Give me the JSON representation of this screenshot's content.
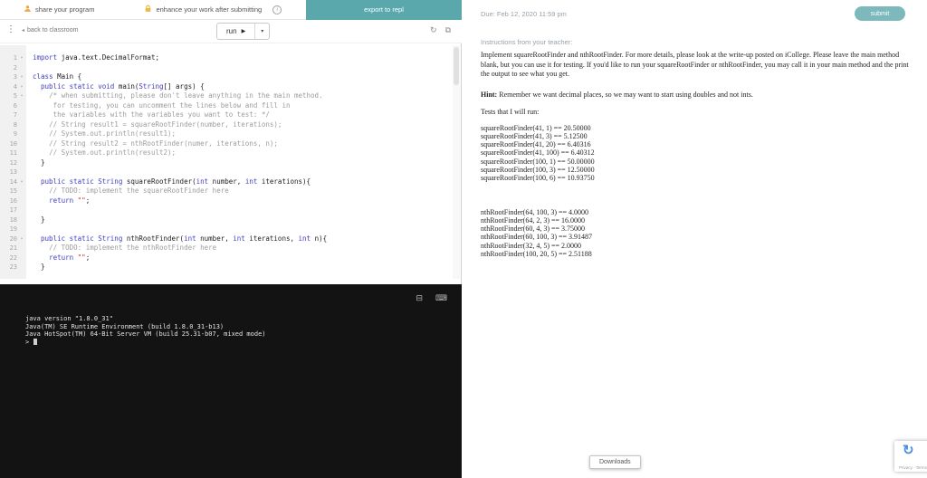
{
  "topbar": {
    "share_label": "share your program",
    "enhance_label": "enhance your work after submitting",
    "export_button": "export to repl"
  },
  "toolbar": {
    "back_label": "back to classroom",
    "run_label": "run"
  },
  "icons": {
    "kebab": "⋮",
    "back_chevron": "◂",
    "play": "▶",
    "caret_down": "▾",
    "refresh": "↻",
    "popout": "⧉",
    "console_pane": "⊟",
    "keyboard": "⌨",
    "info": "i",
    "fold": "▾",
    "recaptcha": "↻"
  },
  "editor": {
    "lines": [
      {
        "n": "1",
        "fold": true,
        "segs": [
          {
            "c": "kw",
            "t": "import"
          },
          {
            "c": "p",
            "t": " java.text.DecimalFormat;"
          }
        ]
      },
      {
        "n": "2",
        "segs": []
      },
      {
        "n": "3",
        "fold": true,
        "segs": [
          {
            "c": "kw",
            "t": "class"
          },
          {
            "c": "p",
            "t": " Main {"
          }
        ]
      },
      {
        "n": "4",
        "fold": true,
        "segs": [
          {
            "c": "p",
            "t": "  "
          },
          {
            "c": "kw",
            "t": "public static void"
          },
          {
            "c": "p",
            "t": " main("
          },
          {
            "c": "kw",
            "t": "String"
          },
          {
            "c": "p",
            "t": "[] args) {"
          }
        ]
      },
      {
        "n": "5",
        "fold": true,
        "segs": [
          {
            "c": "p",
            "t": "    "
          },
          {
            "c": "cmt",
            "t": "/* when submitting, please don't leave anything in the main method."
          }
        ]
      },
      {
        "n": "6",
        "segs": [
          {
            "c": "p",
            "t": "     "
          },
          {
            "c": "cmt",
            "t": "for testing, you can uncomment the lines below and fill in"
          }
        ]
      },
      {
        "n": "7",
        "segs": [
          {
            "c": "p",
            "t": "     "
          },
          {
            "c": "cmt",
            "t": "the variables with the variables you want to test: */"
          }
        ]
      },
      {
        "n": "8",
        "segs": [
          {
            "c": "p",
            "t": "    "
          },
          {
            "c": "cmt",
            "t": "// String result1 = squareRootFinder(number, iterations);"
          }
        ]
      },
      {
        "n": "9",
        "segs": [
          {
            "c": "p",
            "t": "    "
          },
          {
            "c": "cmt",
            "t": "// System.out.println(result1);"
          }
        ]
      },
      {
        "n": "10",
        "segs": [
          {
            "c": "p",
            "t": "    "
          },
          {
            "c": "cmt",
            "t": "// String result2 = nthRootFinder(numer, iterations, n);"
          }
        ]
      },
      {
        "n": "11",
        "segs": [
          {
            "c": "p",
            "t": "    "
          },
          {
            "c": "cmt",
            "t": "// System.out.println(result2);"
          }
        ]
      },
      {
        "n": "12",
        "segs": [
          {
            "c": "p",
            "t": "  }"
          }
        ]
      },
      {
        "n": "13",
        "segs": []
      },
      {
        "n": "14",
        "fold": true,
        "segs": [
          {
            "c": "p",
            "t": "  "
          },
          {
            "c": "kw",
            "t": "public static String"
          },
          {
            "c": "p",
            "t": " squareRootFinder("
          },
          {
            "c": "kw",
            "t": "int"
          },
          {
            "c": "p",
            "t": " number, "
          },
          {
            "c": "kw",
            "t": "int"
          },
          {
            "c": "p",
            "t": " iterations){"
          }
        ]
      },
      {
        "n": "15",
        "segs": [
          {
            "c": "p",
            "t": "    "
          },
          {
            "c": "cmt",
            "t": "// TODO: implement the squareRootFinder here"
          }
        ]
      },
      {
        "n": "16",
        "segs": [
          {
            "c": "p",
            "t": "    "
          },
          {
            "c": "kw",
            "t": "return"
          },
          {
            "c": "p",
            "t": " "
          },
          {
            "c": "str",
            "t": "\"\""
          },
          {
            "c": "p",
            "t": ";"
          }
        ]
      },
      {
        "n": "17",
        "segs": []
      },
      {
        "n": "18",
        "segs": [
          {
            "c": "p",
            "t": "  }"
          }
        ]
      },
      {
        "n": "19",
        "segs": []
      },
      {
        "n": "20",
        "fold": true,
        "segs": [
          {
            "c": "p",
            "t": "  "
          },
          {
            "c": "kw",
            "t": "public static String"
          },
          {
            "c": "p",
            "t": " nthRootFinder("
          },
          {
            "c": "kw",
            "t": "int"
          },
          {
            "c": "p",
            "t": " number, "
          },
          {
            "c": "kw",
            "t": "int"
          },
          {
            "c": "p",
            "t": " iterations, "
          },
          {
            "c": "kw",
            "t": "int"
          },
          {
            "c": "p",
            "t": " n){"
          }
        ]
      },
      {
        "n": "21",
        "segs": [
          {
            "c": "p",
            "t": "    "
          },
          {
            "c": "cmt",
            "t": "// TODO: implement the nthRootFinder here"
          }
        ]
      },
      {
        "n": "22",
        "segs": [
          {
            "c": "p",
            "t": "    "
          },
          {
            "c": "kw",
            "t": "return"
          },
          {
            "c": "p",
            "t": " "
          },
          {
            "c": "str",
            "t": "\"\""
          },
          {
            "c": "p",
            "t": ";"
          }
        ]
      },
      {
        "n": "23",
        "segs": [
          {
            "c": "p",
            "t": "  }"
          }
        ]
      }
    ]
  },
  "console": {
    "lines": [
      "java version \"1.8.0_31\"",
      "Java(TM) SE Runtime Environment (build 1.8.0_31-b13)",
      "Java HotSpot(TM) 64-Bit Server VM (build 25.31-b07, mixed mode)"
    ],
    "prompt": ">"
  },
  "assignment": {
    "due_label": "Due: Feb 12, 2020 11:59 pm",
    "submit_button": "submit",
    "instructions_header": "Instructions from your teacher:",
    "paragraph": "Implement squareRootFinder and nthRootFinder. For more details, please look at the write-up posted on iCollege. Please leave the main method blank, but you can use it for testing. If you'd like to run your squareRootFinder or nthRootFinder, you may call it in your main method and the print the output to see what you get.",
    "hint_label": "Hint:",
    "hint_text": "Remember we want decimal places, so we may want to start using doubles and not ints.",
    "tests_header": "Tests that I will run:",
    "tests_group1": [
      "squareRootFinder(41, 1) == 20.50000",
      "squareRootFinder(41, 3) == 5.12500",
      "squareRootFinder(41, 20) == 6.40316",
      "squareRootFinder(41, 100) == 6.40312",
      "squareRootFinder(100, 1) == 50.00000",
      "squareRootFinder(100, 3) == 12.50000",
      "squareRootFinder(100, 6) == 10.93750"
    ],
    "tests_group2": [
      "nthRootFinder(64, 100, 3) == 4.0000",
      "nthRootFinder(64, 2, 3) == 16.0000",
      "nthRootFinder(60, 4, 3) == 3.75000",
      "nthRootFinder(60, 100, 3) == 3.91487",
      "nthRootFinder(32, 4, 5) == 2.0000",
      "nthRootFinder(100, 20, 5) == 2.51188"
    ]
  },
  "tooltip": {
    "downloads": "Downloads"
  },
  "recaptcha": {
    "privacy_terms": "Privacy - Terms"
  },
  "colors": {
    "accent_teal": "#5aa8ac",
    "submit_teal": "#7db9bc",
    "console_bg": "#131313",
    "keyword": "#4040c2",
    "comment": "#9c9c9c",
    "string": "#c0392b"
  }
}
